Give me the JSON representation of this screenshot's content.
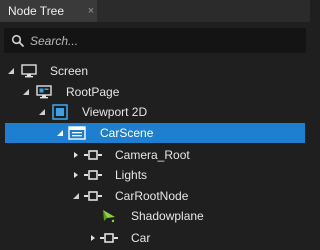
{
  "panel": {
    "tab_label": "Node Tree",
    "close_glyph": "×"
  },
  "search": {
    "placeholder": "Search...",
    "value": ""
  },
  "tree": {
    "nodes": [
      {
        "label": "Screen",
        "icon": "monitor-icon",
        "depth": 0,
        "expanded": true
      },
      {
        "label": "RootPage",
        "icon": "page-icon",
        "depth": 1,
        "expanded": true
      },
      {
        "label": "Viewport 2D",
        "icon": "viewport-icon",
        "depth": 2,
        "expanded": true
      },
      {
        "label": "CarScene",
        "icon": "scene-icon",
        "depth": 3,
        "expanded": true,
        "selected": true
      },
      {
        "label": "Camera_Root",
        "icon": "node-icon",
        "depth": 4,
        "expanded": false
      },
      {
        "label": "Lights",
        "icon": "node-icon",
        "depth": 4,
        "expanded": false
      },
      {
        "label": "CarRootNode",
        "icon": "node-icon",
        "depth": 4,
        "expanded": true
      },
      {
        "label": "Shadowplane",
        "icon": "plane-icon",
        "depth": 5,
        "expanded": null
      },
      {
        "label": "Car",
        "icon": "node-icon",
        "depth": 5,
        "expanded": false
      }
    ]
  },
  "colors": {
    "selection": "#1e7fd0",
    "background": "#1f1f1f",
    "viewport_icon": "#3aa3e8",
    "plane_icon": "#8fd33a"
  }
}
